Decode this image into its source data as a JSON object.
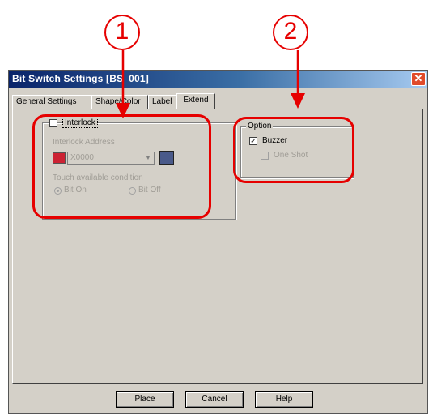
{
  "window": {
    "title": "Bit Switch Settings [BS_001]"
  },
  "tabs": [
    {
      "label": "General Settings"
    },
    {
      "label": "Shape/Color"
    },
    {
      "label": "Label"
    },
    {
      "label": "Extend"
    }
  ],
  "interlock": {
    "checkbox_label": "Interlock",
    "address_label": "Interlock Address",
    "address_value": "X0000",
    "touch_condition_label": "Touch available condition",
    "radio_on_label": "Bit On",
    "radio_off_label": "Bit Off"
  },
  "option": {
    "title": "Option",
    "buzzer_label": "Buzzer",
    "buzzer_checked_mark": "✓",
    "one_shot_label": "One Shot"
  },
  "buttons": {
    "place": "Place",
    "cancel": "Cancel",
    "help": "Help"
  },
  "annotations": {
    "callout_1": "1",
    "callout_2": "2"
  },
  "colors": {
    "annotation_red": "#e60000",
    "title_bar": "#0a246a"
  }
}
